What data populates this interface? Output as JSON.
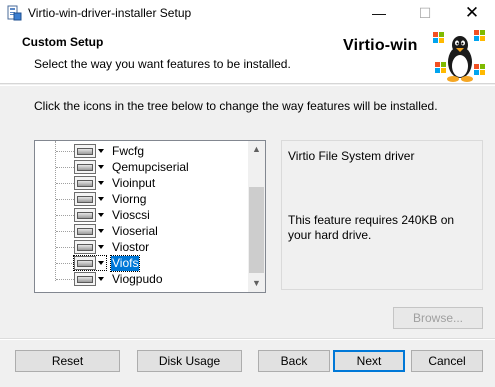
{
  "window": {
    "title": "Virtio-win-driver-installer Setup",
    "controls": {
      "minimize": "—",
      "maximize": "☐",
      "close": "✕"
    },
    "icon": "installer-icon"
  },
  "banner": {
    "title": "Custom Setup",
    "subtitle": "Select the way you want features to be installed.",
    "brand": "Virtio-win",
    "logo": "tux-windows-logo"
  },
  "instructions": "Click the icons in the tree below to change the way features will be installed.",
  "tree": {
    "items": [
      {
        "label": "Fwcfg",
        "icon": "drive-icon"
      },
      {
        "label": "Qemupciserial",
        "icon": "drive-icon"
      },
      {
        "label": "Vioinput",
        "icon": "drive-icon"
      },
      {
        "label": "Viorng",
        "icon": "drive-icon"
      },
      {
        "label": "Vioscsi",
        "icon": "drive-icon"
      },
      {
        "label": "Vioserial",
        "icon": "drive-icon"
      },
      {
        "label": "Viostor",
        "icon": "drive-icon"
      },
      {
        "label": "Viofs",
        "icon": "drive-icon",
        "selected": true
      },
      {
        "label": "Viogpudo",
        "icon": "drive-icon"
      }
    ],
    "scrollbar": {
      "up": "▲",
      "down": "▼"
    }
  },
  "description": {
    "name": "Virtio File System driver",
    "requirement": "This feature requires 240KB on your hard drive."
  },
  "buttons": {
    "browse": "Browse...",
    "reset": "Reset",
    "disk_usage": "Disk Usage",
    "back": "Back",
    "next": "Next",
    "cancel": "Cancel"
  },
  "colors": {
    "selection": "#0078d7",
    "button_face": "#e1e1e1",
    "dialog": "#f0f0f0"
  }
}
